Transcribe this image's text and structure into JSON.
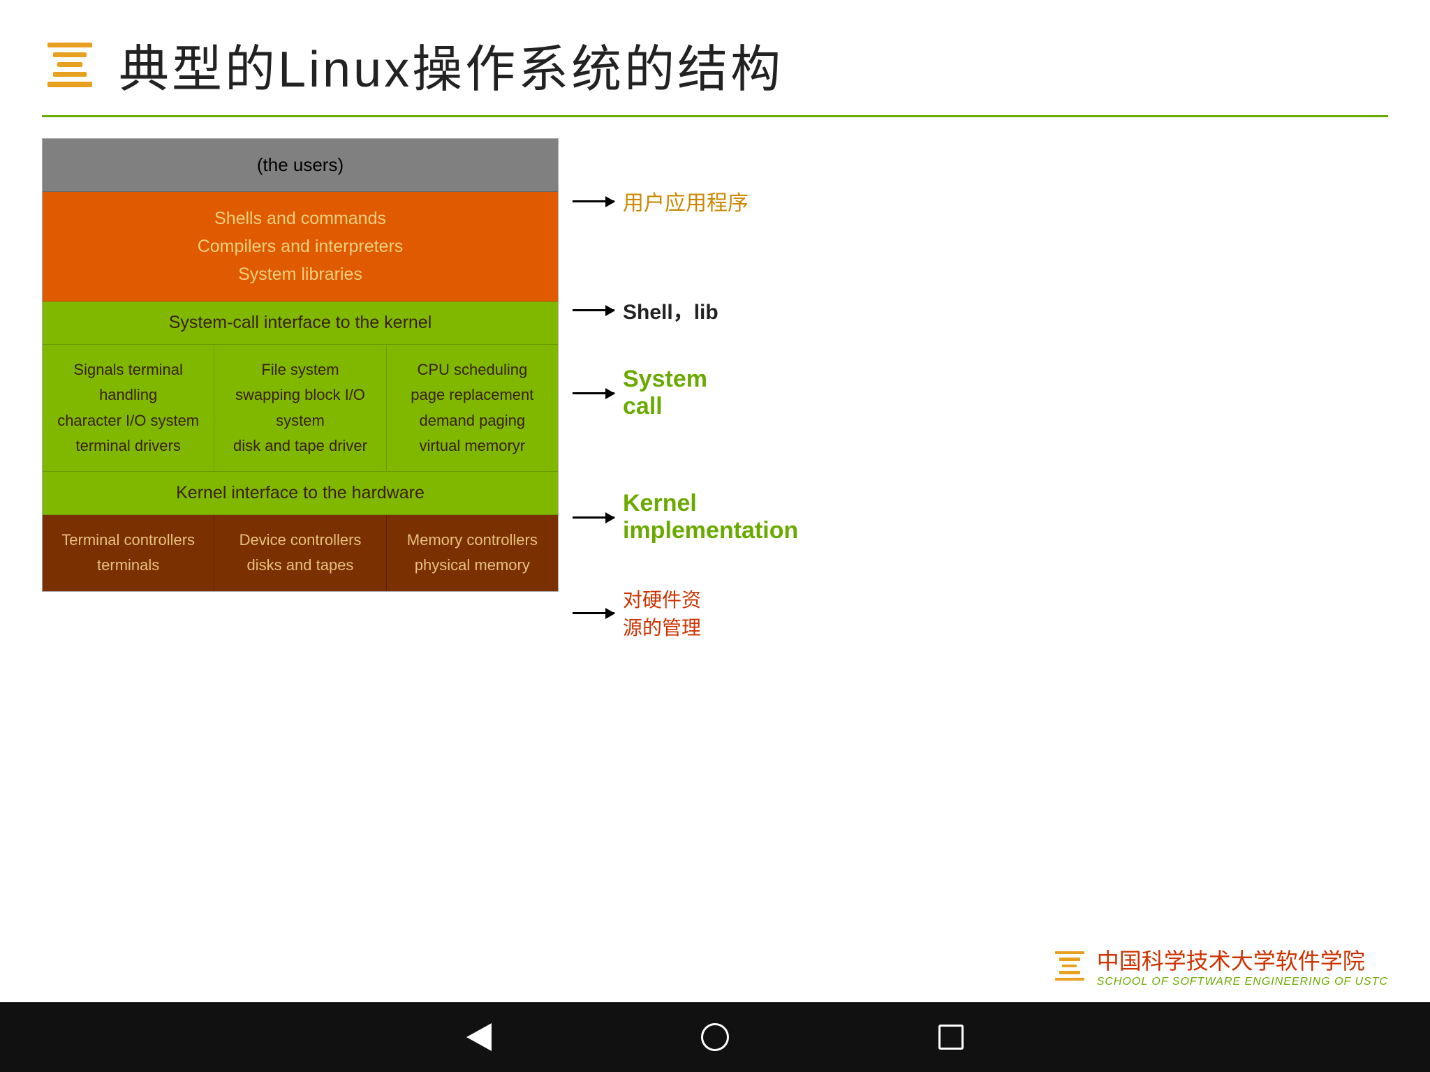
{
  "header": {
    "title": "典型的Linux操作系统的结构"
  },
  "diagram": {
    "users_layer": "(the users)",
    "orange_layer": {
      "line1": "Shells and commands",
      "line2": "Compilers and interpreters",
      "line3": "System libraries"
    },
    "syscall_layer": "System-call interface to the kernel",
    "kernel_cols": [
      {
        "lines": [
          "Signals terminal",
          "handling",
          "character I/O system",
          "terminal    drivers"
        ]
      },
      {
        "lines": [
          "File system",
          "swapping block I/O",
          "system",
          "disk and tape driver"
        ]
      },
      {
        "lines": [
          "CPU scheduling",
          "page replacement",
          "demand paging",
          "virtual memoryr"
        ]
      }
    ],
    "hardware_layer": "Kernel interface to the hardware",
    "controller_cols": [
      {
        "lines": [
          "Terminal controllers",
          "terminals"
        ]
      },
      {
        "lines": [
          "Device controllers",
          "disks and tapes"
        ]
      },
      {
        "lines": [
          "Memory controllers",
          "physical memory"
        ]
      }
    ]
  },
  "annotations": {
    "users": "用户应用程序",
    "shell": "Shell，lib",
    "syscall_line1": "System",
    "syscall_line2": "call",
    "kernel_line1": "Kernel",
    "kernel_line2": "implementation",
    "hardware_line1": "对硬件资",
    "hardware_line2": "源的管理"
  },
  "footer": {
    "main_text": "中国科学技术大学软件学院",
    "sub_text": "SCHOOL OF SOFTWARE ENGINEERING OF USTC"
  },
  "navbar": {
    "back_label": "back",
    "home_label": "home",
    "recent_label": "recent"
  }
}
